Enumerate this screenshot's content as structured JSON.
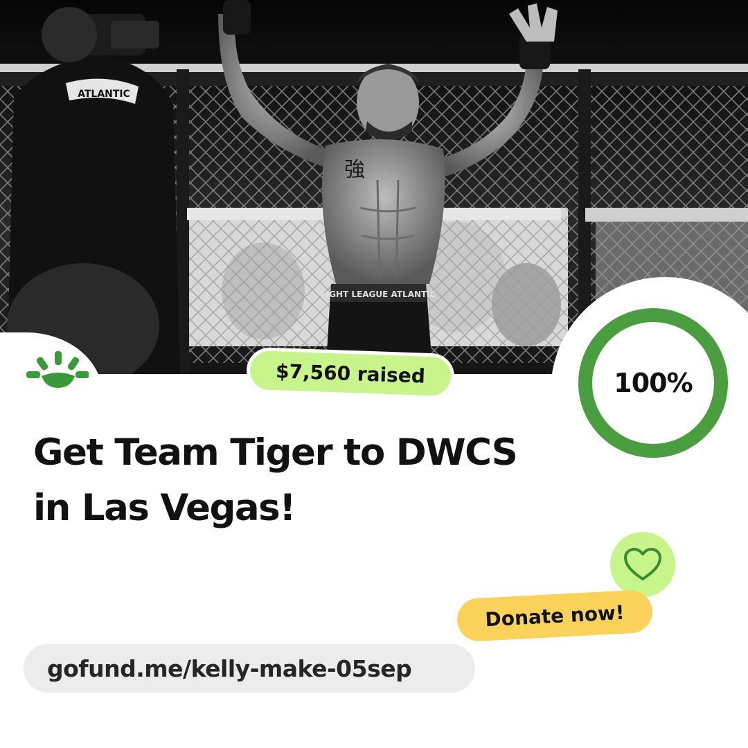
{
  "campaign": {
    "raised_label": "$7,560 raised",
    "progress_label": "100%",
    "progress_fraction": 1.0,
    "title_line1": "Get Team  Tiger to DWCS",
    "title_line2": "in Las Vegas!",
    "donate_label": "Donate now!",
    "url": "gofund.me/kelly-make-05sep"
  },
  "photo": {
    "shorts_waistband_text": "FIGHT LEAGUE ATLANTIC",
    "shirt_text": "ATLANTIC"
  },
  "colors": {
    "brand_green": "#3a9a3a",
    "progress_green": "#4a9e3f",
    "light_green": "#c7f48b",
    "yellow": "#fad25a",
    "pill_grey": "#ececec",
    "text": "#111111"
  },
  "icons": {
    "logo": "gofundme-sunrise-icon",
    "heart": "heart-outline-icon"
  }
}
